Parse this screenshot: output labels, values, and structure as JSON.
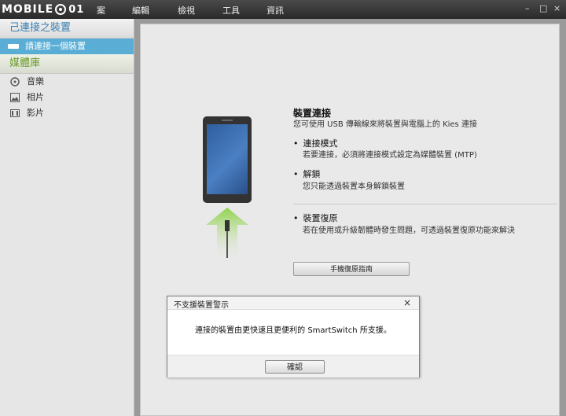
{
  "logo": {
    "text": "MOBILE",
    "suffix": "01"
  },
  "menu": {
    "file_fragment": "案",
    "edit": "編輯",
    "view": "檢視",
    "tools": "工具",
    "info": "資訊"
  },
  "window_controls": {
    "minimize": "–",
    "maximize": "□",
    "close": "×"
  },
  "sidebar": {
    "connected_heading": "己連接之裝置",
    "connect_prompt": "請連接一個裝置",
    "library_heading": "媒體庫",
    "items": [
      {
        "label": "音樂",
        "icon": "music-disc-icon"
      },
      {
        "label": "相片",
        "icon": "photo-icon"
      },
      {
        "label": "影片",
        "icon": "video-icon"
      }
    ]
  },
  "content": {
    "title": "裝置連接",
    "description": "您可使用 USB 傳輸線來將裝置與電腦上的 Kies 連接",
    "bullets": [
      {
        "heading": "連接模式",
        "text": "若要連接，必須將連接模式設定為媒體裝置 (MTP)"
      },
      {
        "heading": "解鎖",
        "text": "您只能透過裝置本身解鎖裝置"
      },
      {
        "heading": "裝置復原",
        "text": "若在使用或升級韌體時發生問題，可透過裝置復原功能來解決"
      }
    ],
    "restore_button": "手機復原指南"
  },
  "dialog": {
    "title": "不支援裝置警示",
    "close": "×",
    "message": "連接的裝置由更快速且更便利的 SmartSwitch 所支援。",
    "ok_button": "確認"
  },
  "colors": {
    "accent_blue": "#5aaed6",
    "heading_blue": "#3a7fb0",
    "library_green": "#6a9a2a",
    "arrow_green": "#6cbf2a"
  }
}
